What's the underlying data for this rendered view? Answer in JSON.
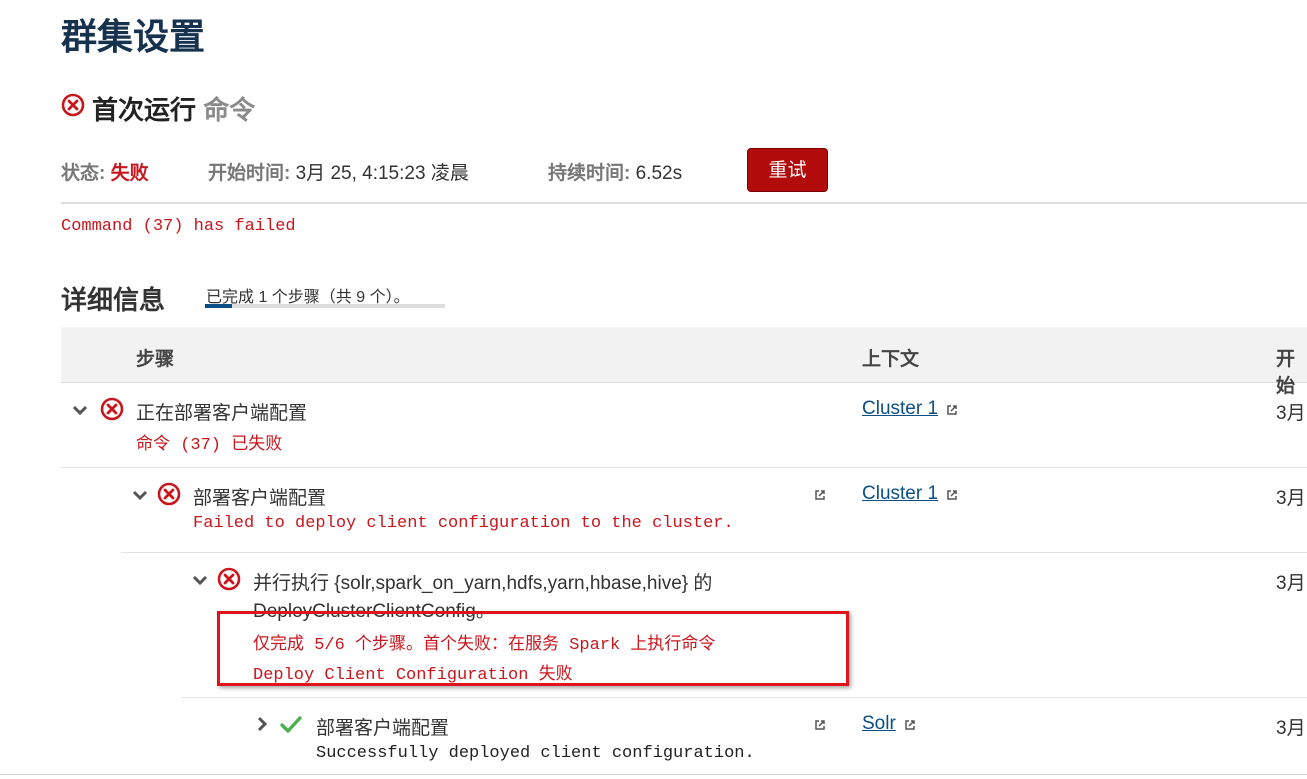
{
  "page": {
    "title": "群集设置"
  },
  "command": {
    "name": "首次运行",
    "kind": "命令",
    "status_label": "状态:",
    "status_value": "失败",
    "start_label": "开始时间:",
    "start_value": "3月 25, 4:15:23 凌晨",
    "duration_label": "持续时间:",
    "duration_value": "6.52s",
    "retry_label": "重试",
    "error_message": "Command (37) has failed"
  },
  "details": {
    "title": "详细信息",
    "progress_text": "已完成 1 个步骤（共 9 个）。",
    "progress_fraction": 0.111
  },
  "table": {
    "headers": {
      "step": "步骤",
      "context": "上下文",
      "start": "开始"
    },
    "rows": [
      {
        "title": "正在部署客户端配置",
        "subtitle": "命令 (37) 已失败",
        "context": "Cluster 1",
        "start": "3月"
      },
      {
        "title": "部署客户端配置",
        "subtitle": "Failed to deploy client configuration to the cluster.",
        "context": "Cluster 1",
        "start": "3月"
      },
      {
        "title_line1": "并行执行 {solr,spark_on_yarn,hdfs,yarn,hbase,hive} 的",
        "title_line2": "DeployClusterClientConfig。",
        "subtitle_line1": "仅完成 5/6 个步骤。首个失败：在服务 Spark 上执行命令",
        "subtitle_line2": "Deploy Client Configuration 失败",
        "start": "3月"
      },
      {
        "title": "部署客户端配置",
        "subtitle": "Successfully deployed client configuration.",
        "context": "Solr",
        "start": "3月"
      }
    ]
  },
  "colors": {
    "error": "#c8161d",
    "success": "#4caf50",
    "link": "#0b4f85",
    "retry_bg": "#b20b0b",
    "header_bg": "#f2f2f2",
    "highlight": "#e0141a"
  }
}
